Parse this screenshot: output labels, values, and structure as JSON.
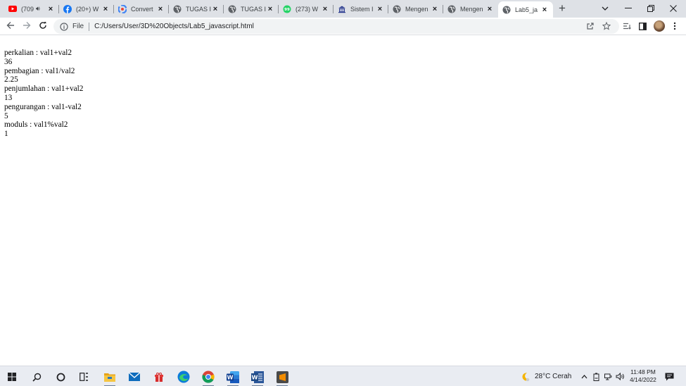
{
  "tabs": [
    {
      "title": "(709",
      "favicon": "youtube-icon",
      "extra": "speaker-icon"
    },
    {
      "title": "(20+) W",
      "favicon": "facebook-icon"
    },
    {
      "title": "Convert",
      "favicon": "google-icon"
    },
    {
      "title": "TUGAS I",
      "favicon": "globe-icon"
    },
    {
      "title": "TUGAS I",
      "favicon": "globe-icon"
    },
    {
      "title": "(273) W",
      "favicon": "whatsapp-icon"
    },
    {
      "title": "Sistem I",
      "favicon": "university-icon"
    },
    {
      "title": "Mengen",
      "favicon": "globe-icon"
    },
    {
      "title": "Mengen",
      "favicon": "globe-icon"
    },
    {
      "title": "Lab5_ja",
      "favicon": "globe-icon",
      "active": true
    }
  ],
  "omnibox": {
    "scheme_label": "File",
    "url": "C:/Users/User/3D%20Objects/Lab5_javascript.html"
  },
  "page": {
    "lines": [
      "perkalian : val1+val2",
      "36",
      "pembagian : val1/val2",
      "2.25",
      "penjumlahan : val1+val2",
      "13",
      "pengurangan : val1-val2",
      "5",
      "moduls : val1%val2",
      "1"
    ]
  },
  "taskbar": {
    "weather": "28°C  Cerah",
    "time": "11:48 PM",
    "date": "4/14/2022"
  },
  "colors": {
    "tabstrip": "#dee1e6",
    "youtube": "#ff0000",
    "facebook": "#1877f2",
    "whatsapp": "#25d366",
    "edge": "#0c7bd9",
    "word": "#2b579a",
    "sublime": "#f28c00"
  }
}
